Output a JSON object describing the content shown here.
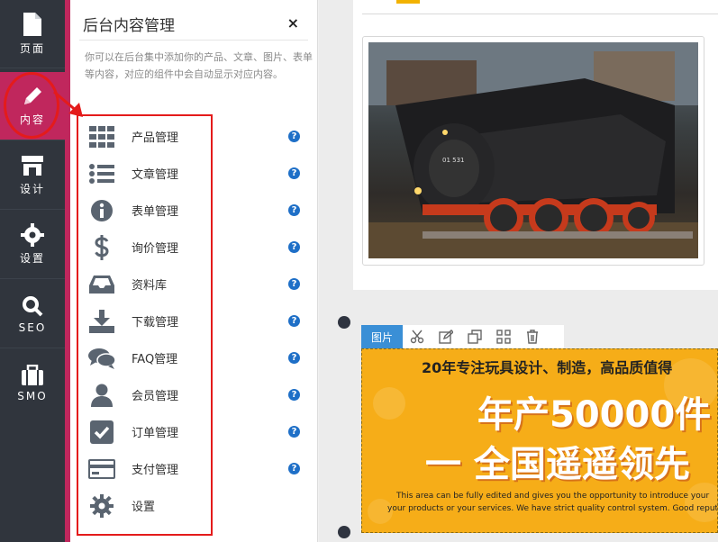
{
  "nav": [
    {
      "label": "页面",
      "icon": "page-icon"
    },
    {
      "label": "内容",
      "icon": "pencil-icon",
      "active": true
    },
    {
      "label": "设计",
      "icon": "store-icon"
    },
    {
      "label": "设置",
      "icon": "gear-icon"
    },
    {
      "label": "SEO",
      "icon": "search-icon"
    },
    {
      "label": "SMO",
      "icon": "briefcase-icon"
    }
  ],
  "panel": {
    "title": "后台内容管理",
    "close": "×",
    "description": "你可以在后台集中添加你的产品、文章、图片、表单等内容，对应的组件中会自动显示对应内容。"
  },
  "menu": [
    {
      "label": "产品管理",
      "icon": "grid-icon"
    },
    {
      "label": "文章管理",
      "icon": "list-icon"
    },
    {
      "label": "表单管理",
      "icon": "info-icon"
    },
    {
      "label": "询价管理",
      "icon": "dollar-icon"
    },
    {
      "label": "资料库",
      "icon": "inbox-icon"
    },
    {
      "label": "下载管理",
      "icon": "download-icon"
    },
    {
      "label": "FAQ管理",
      "icon": "chat-icon"
    },
    {
      "label": "会员管理",
      "icon": "user-icon"
    },
    {
      "label": "订单管理",
      "icon": "checkbox-icon"
    },
    {
      "label": "支付管理",
      "icon": "credit-card-icon"
    },
    {
      "label": "设置",
      "icon": "gear-icon"
    }
  ],
  "help_glyph": "?",
  "toolbar": {
    "tag": "图片",
    "tools": [
      "scissors-icon",
      "edit-icon",
      "copy-icon",
      "grid-small-icon",
      "trash-icon"
    ]
  },
  "banner": {
    "headline": "20年专注玩具设计、制造，高品质值得",
    "big1": "年产50000件",
    "big2": "一 全国遥遥领先",
    "small1": "This area can be fully edited and gives you the opportunity to introduce your",
    "small2": "your products or your services. We have strict quality control system. Good reput"
  },
  "colors": {
    "nav_bg": "#30353d",
    "accent": "#c0275d",
    "annotation_red": "#e41b1b",
    "help_blue": "#1e6fc7",
    "tag_blue": "#3a8fd6",
    "banner_orange": "#f6ad18"
  }
}
